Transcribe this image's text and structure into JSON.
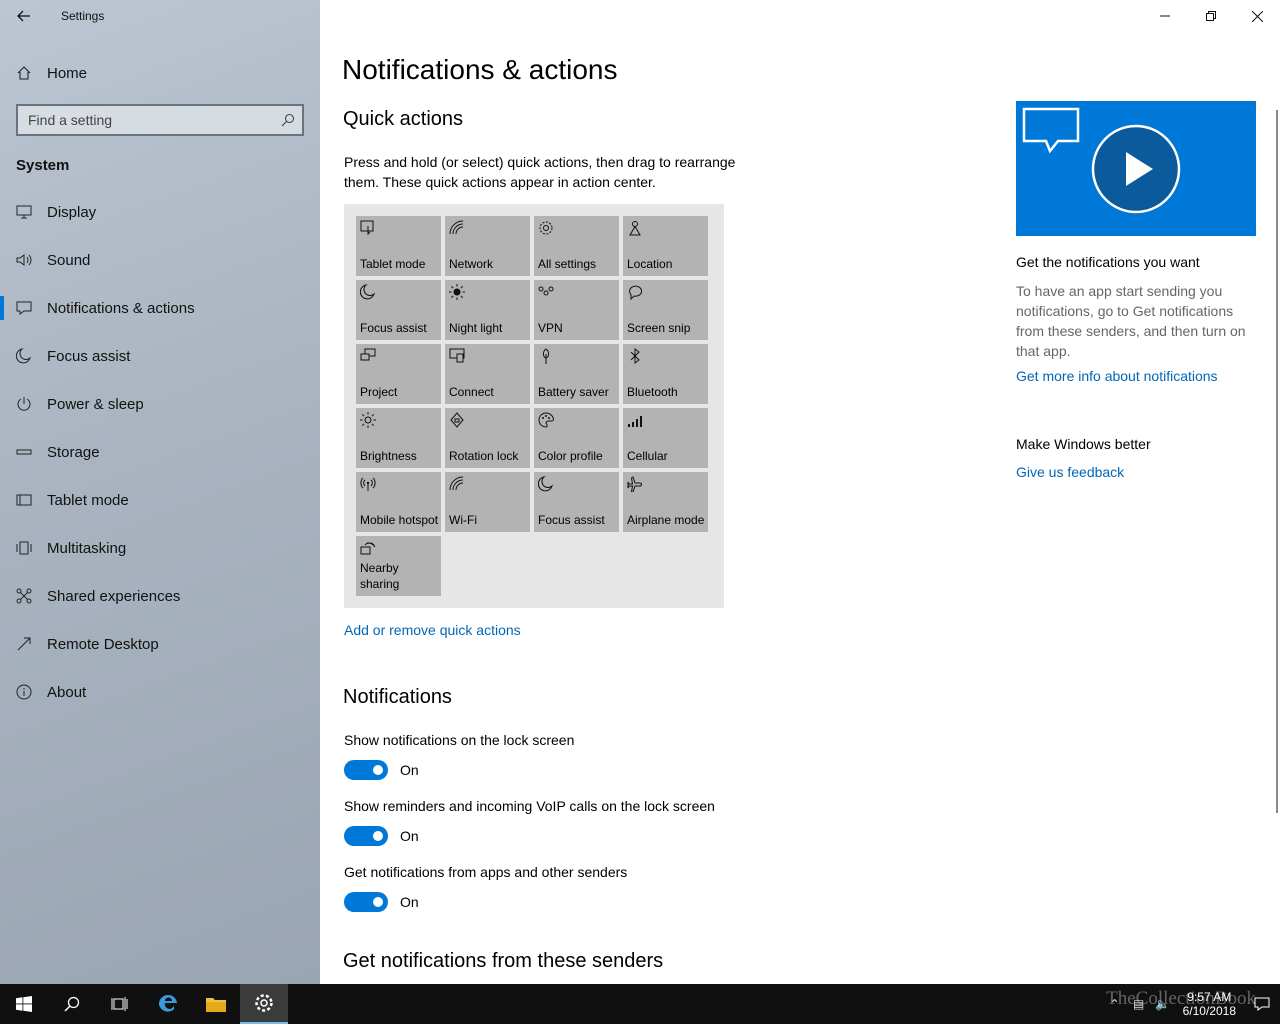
{
  "window": {
    "title": "Settings"
  },
  "sidebar": {
    "home_label": "Home",
    "search_placeholder": "Find a setting",
    "section_label": "System",
    "items": [
      {
        "label": "Display",
        "icon": "monitor-icon"
      },
      {
        "label": "Sound",
        "icon": "speaker-icon"
      },
      {
        "label": "Notifications & actions",
        "icon": "message-icon",
        "active": true
      },
      {
        "label": "Focus assist",
        "icon": "moon-icon"
      },
      {
        "label": "Power & sleep",
        "icon": "power-icon"
      },
      {
        "label": "Storage",
        "icon": "storage-icon"
      },
      {
        "label": "Tablet mode",
        "icon": "tablet-icon"
      },
      {
        "label": "Multitasking",
        "icon": "multitasking-icon"
      },
      {
        "label": "Shared experiences",
        "icon": "shared-icon"
      },
      {
        "label": "Remote Desktop",
        "icon": "remote-icon"
      },
      {
        "label": "About",
        "icon": "info-icon"
      }
    ]
  },
  "main": {
    "title": "Notifications & actions",
    "quick_actions": {
      "heading": "Quick actions",
      "description": "Press and hold (or select) quick actions, then drag to rearrange them. These quick actions appear in action center.",
      "tiles": [
        "Tablet mode",
        "Network",
        "All settings",
        "Location",
        "Focus assist",
        "Night light",
        "VPN",
        "Screen snip",
        "Project",
        "Connect",
        "Battery saver",
        "Bluetooth",
        "Brightness",
        "Rotation lock",
        "Color profile",
        "Cellular",
        "Mobile hotspot",
        "Wi-Fi",
        "Focus assist",
        "Airplane mode",
        "Nearby sharing"
      ],
      "link": "Add or remove quick actions"
    },
    "notifications": {
      "heading": "Notifications",
      "settings": [
        {
          "label": "Show notifications on the lock screen",
          "state": "On"
        },
        {
          "label": "Show reminders and incoming VoIP calls on the lock screen",
          "state": "On"
        },
        {
          "label": "Get notifications from apps and other senders",
          "state": "On"
        }
      ]
    },
    "senders_heading": "Get notifications from these senders"
  },
  "right_pane": {
    "title": "Get the notifications you want",
    "text": "To have an app start sending you notifications, go to Get notifications from these senders, and then turn on that app.",
    "link": "Get more info about notifications",
    "feedback_title": "Make Windows better",
    "feedback_link": "Give us feedback"
  },
  "taskbar": {
    "time": "9:57 AM",
    "date": "6/10/2018",
    "watermark": "TheCollectionBook"
  },
  "colors": {
    "accent": "#0078d7",
    "link": "#0067b8",
    "tile": "#b3b3b3"
  }
}
